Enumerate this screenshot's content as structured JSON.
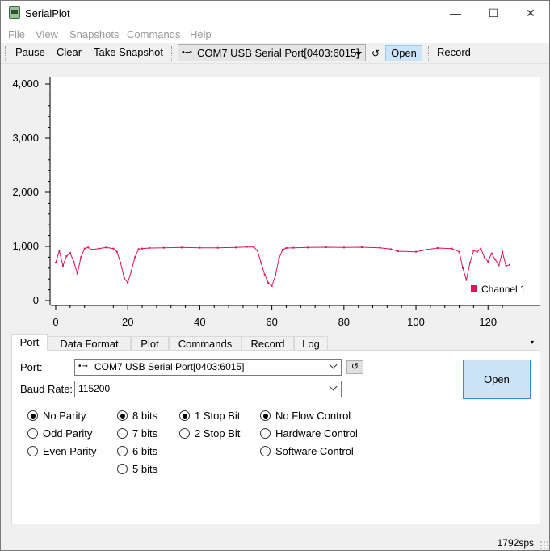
{
  "window": {
    "title": "SerialPlot",
    "minimize_glyph": "—",
    "maximize_glyph": "☐",
    "close_glyph": "✕"
  },
  "menu": [
    "File",
    "View",
    "Snapshots",
    "Commands",
    "Help"
  ],
  "toolbar": {
    "pause_label": "Pause",
    "clear_label": "Clear",
    "snapshot_label": "Take Snapshot",
    "port_value": "COM7 USB Serial Port[0403:6015]",
    "open_label": "Open",
    "record_label": "Record"
  },
  "chart_data": {
    "type": "line",
    "title": "",
    "xlabel": "",
    "ylabel": "",
    "xlim": [
      0,
      126
    ],
    "ylim": [
      0,
      4000
    ],
    "xticks": [
      0,
      20,
      40,
      60,
      80,
      100,
      120
    ],
    "yticks": [
      0,
      1000,
      2000,
      3000,
      4000
    ],
    "ytick_labels": [
      "0",
      "1,000",
      "2,000",
      "3,000",
      "4,000"
    ],
    "grid": false,
    "legend_position": "bottom-right",
    "line_color": "#e0135a",
    "series": [
      {
        "name": "Channel 1",
        "x": [
          0,
          1,
          2,
          3,
          4,
          5,
          6,
          7,
          8,
          9,
          10,
          12,
          14,
          16,
          17,
          18,
          19,
          20,
          21,
          22,
          23,
          24,
          26,
          30,
          35,
          40,
          45,
          50,
          53,
          55,
          56,
          57,
          58,
          59,
          60,
          61,
          62,
          63,
          64,
          66,
          70,
          75,
          80,
          85,
          90,
          93,
          95,
          100,
          103,
          106,
          110,
          112,
          113,
          114,
          115,
          116,
          117,
          118,
          119,
          120,
          121,
          122,
          123,
          124,
          125,
          126
        ],
        "y": [
          700,
          920,
          640,
          820,
          880,
          720,
          500,
          800,
          960,
          980,
          940,
          960,
          980,
          960,
          900,
          700,
          420,
          330,
          550,
          800,
          950,
          960,
          970,
          975,
          980,
          975,
          975,
          980,
          990,
          990,
          920,
          700,
          480,
          330,
          270,
          470,
          780,
          940,
          970,
          975,
          980,
          985,
          980,
          985,
          975,
          950,
          910,
          900,
          940,
          970,
          960,
          900,
          600,
          380,
          700,
          920,
          900,
          960,
          800,
          720,
          870,
          760,
          650,
          900,
          640,
          660
        ]
      }
    ]
  },
  "tabs": [
    "Port",
    "Data Format",
    "Plot",
    "Commands",
    "Record",
    "Log"
  ],
  "tab_more": "▾",
  "port_panel": {
    "port_label": "Port:",
    "port_value": "COM7 USB Serial Port[0403:6015]",
    "baud_label": "Baud Rate:",
    "baud_value": "115200",
    "open_label": "Open",
    "parity": [
      {
        "label": "No Parity",
        "checked": true
      },
      {
        "label": "Odd Parity",
        "checked": false
      },
      {
        "label": "Even Parity",
        "checked": false
      }
    ],
    "data_bits": [
      {
        "label": "8 bits",
        "checked": true
      },
      {
        "label": "7 bits",
        "checked": false
      },
      {
        "label": "6 bits",
        "checked": false
      },
      {
        "label": "5 bits",
        "checked": false
      }
    ],
    "stop_bits": [
      {
        "label": "1 Stop Bit",
        "checked": true
      },
      {
        "label": "2 Stop Bit",
        "checked": false
      }
    ],
    "flow_control": [
      {
        "label": "No Flow Control",
        "checked": true
      },
      {
        "label": "Hardware Control",
        "checked": false
      },
      {
        "label": "Software Control",
        "checked": false
      }
    ]
  },
  "status": {
    "sps": "1792sps"
  }
}
